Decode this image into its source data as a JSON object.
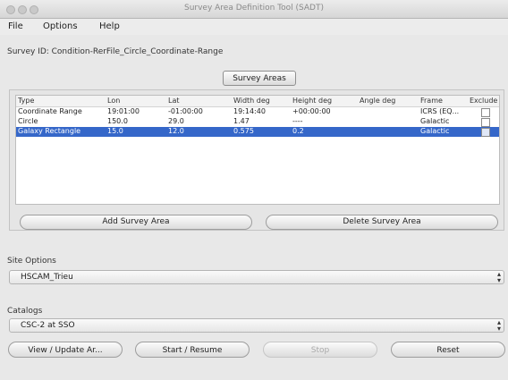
{
  "window": {
    "title": "Survey Area Definition Tool (SADT)"
  },
  "menu": [
    "File",
    "Options",
    "Help"
  ],
  "survey_id": "Survey ID: Condition-RerFile_Circle_Coordinate-Range",
  "survey_areas_button": "Survey Areas",
  "table": {
    "headers": [
      "Type",
      "Lon",
      "Lat",
      "Width deg",
      "Height deg",
      "Angle deg",
      "Frame",
      "Exclude"
    ],
    "rows": [
      {
        "type": "Coordinate Range",
        "lon": "19:01:00",
        "lat": "-01:00:00",
        "width": "19:14:40",
        "height": "+00:00:00",
        "angle": "",
        "frame": "ICRS (EQ...",
        "exclude": false,
        "selected": false
      },
      {
        "type": "Circle",
        "lon": "150.0",
        "lat": "29.0",
        "width": "1.47",
        "height": "----",
        "angle": "",
        "frame": "Galactic",
        "exclude": false,
        "selected": false
      },
      {
        "type": "Galaxy Rectangle",
        "lon": "15.0",
        "lat": "12.0",
        "width": "0.575",
        "height": "0.2",
        "angle": "",
        "frame": "Galactic",
        "exclude": false,
        "selected": true
      }
    ]
  },
  "add_button": "Add Survey Area",
  "delete_button": "Delete Survey Area",
  "instrument": {
    "label": "Site Options",
    "value": "HSCAM_Trieu"
  },
  "catalogue": {
    "label": "Catalogs",
    "value": "CSC-2 at SSO"
  },
  "bottom_buttons": {
    "view_update": "View / Update Ar...",
    "start_resume": "Start / Resume",
    "stop": "Stop",
    "reset": "Reset"
  }
}
